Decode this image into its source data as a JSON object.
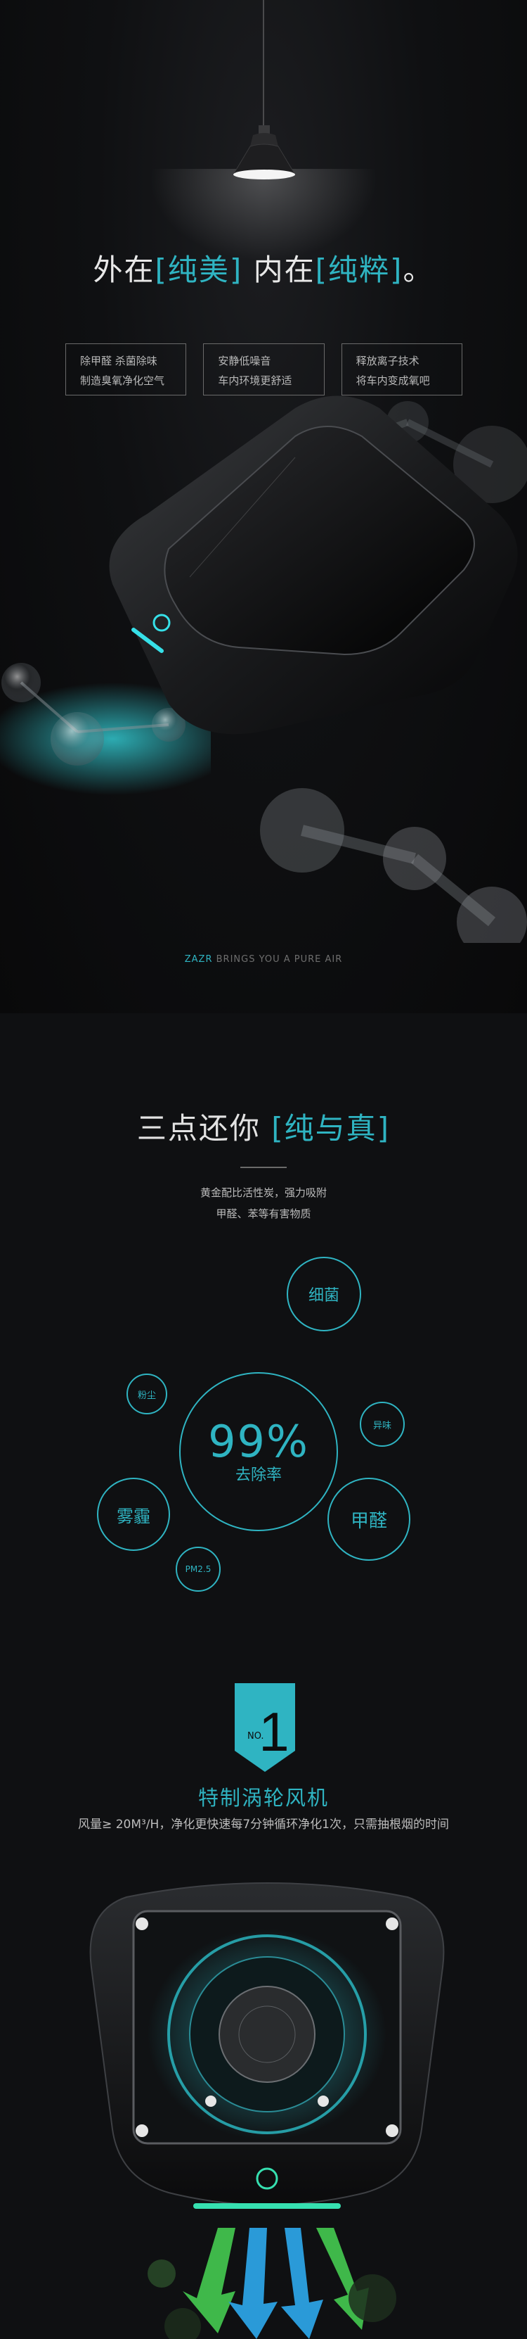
{
  "hero": {
    "title_a": "外在",
    "title_b": "[纯美]",
    "title_c": " 内在",
    "title_d": "[纯粹]",
    "title_e": "。",
    "features": [
      {
        "line1": "除甲醛 杀菌除味",
        "line2": "制造臭氧净化空气"
      },
      {
        "line1": "安静低噪音",
        "line2": "车内环境更舒适"
      },
      {
        "line1": "释放离子技术",
        "line2": "将车内变成氧吧"
      }
    ],
    "tagline_brand": "ZAZR",
    "tagline_rest": " BRINGS YOU A PURE AIR"
  },
  "section2": {
    "title_a": "三点还你 ",
    "title_b": "[纯与真]",
    "desc_line1": "黄金配比活性炭，强力吸附",
    "desc_line2": "甲醛、苯等有害物质",
    "center_value": "99%",
    "center_label": "去除率",
    "bubbles": {
      "xijun": "细菌",
      "fenchen": "粉尘",
      "yiwei": "异味",
      "wumai": "雾霾",
      "jiaquan": "甲醛",
      "pm25": "PM2.5"
    }
  },
  "fan": {
    "badge_number": "1",
    "badge_prefix": "NO.",
    "title": "特制涡轮风机",
    "desc": "风量≥ 20M³/H，净化更快速每7分钟循环净化1次，只需抽根烟的时间"
  },
  "colors": {
    "accent": "#2fb4c2",
    "background": "#0c0c0d"
  }
}
